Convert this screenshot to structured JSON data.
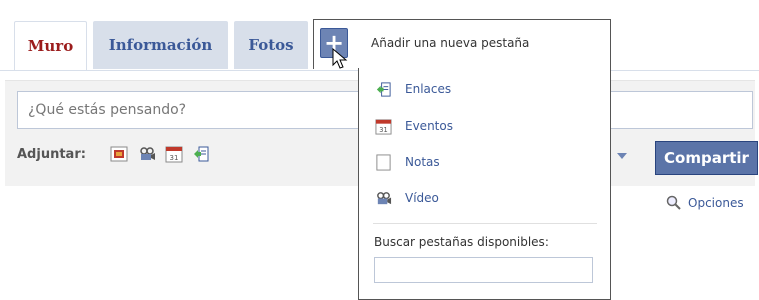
{
  "tabs": [
    {
      "label": "Muro",
      "active": true
    },
    {
      "label": "Información",
      "active": false
    },
    {
      "label": "Fotos",
      "active": false
    }
  ],
  "add_tab": {
    "icon": "plus-icon",
    "label": "Añadir una nueva pestaña"
  },
  "menu": {
    "items": [
      {
        "label": "Enlaces",
        "icon": "link-icon"
      },
      {
        "label": "Eventos",
        "icon": "calendar-icon"
      },
      {
        "label": "Notas",
        "icon": "note-icon"
      },
      {
        "label": "Vídeo",
        "icon": "video-camera-icon"
      }
    ],
    "search_label": "Buscar pestañas disponibles:",
    "search_value": ""
  },
  "composer": {
    "placeholder": "¿Qué estás pensando?",
    "attach_label": "Adjuntar:",
    "attach_icons": [
      "photo-icon",
      "video-camera-icon",
      "calendar-icon",
      "link-icon"
    ],
    "share_label": "Compartir"
  },
  "options_label": "Opciones",
  "colors": {
    "brand": "#3b5998",
    "tab_bg": "#d8dfea",
    "active_tab_text": "#9b1c1c",
    "button": "#5b74a8"
  }
}
